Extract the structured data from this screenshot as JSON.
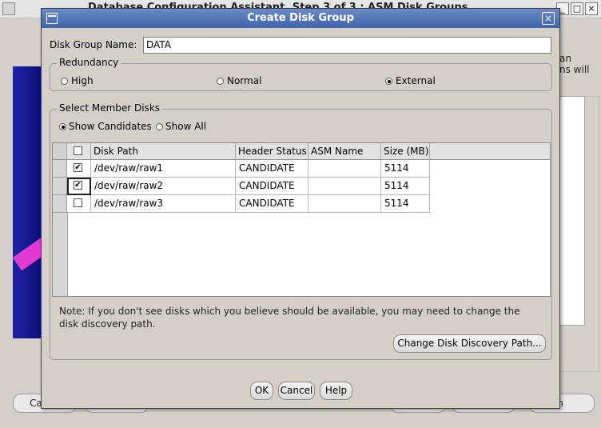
{
  "background_window": {
    "title": "Database Configuration Assistant, Step 3 of 3 : ASM Disk Groups",
    "minimize_label": "_",
    "maximize_label": "□",
    "close_label": "×",
    "right_text": [
      "an",
      "ns will"
    ],
    "bottom_buttons": [
      "Ca",
      "sh"
    ]
  },
  "dialog": {
    "title": "Create Disk Group",
    "close_label": "×",
    "disk_group_name_label": "Disk Group Name:",
    "disk_group_name_value": "DATA",
    "redundancy": {
      "title": "Redundancy",
      "options": [
        "High",
        "Normal",
        "External"
      ],
      "selected": "External"
    },
    "member_disks": {
      "title": "Select Member Disks",
      "filters": [
        "Show Candidates",
        "Show All"
      ],
      "selected_filter": "Show Candidates",
      "columns": [
        "Disk Path",
        "Header Status",
        "ASM Name",
        "Size (MB)"
      ],
      "rows": [
        {
          "checked": true,
          "disk_path": "/dev/raw/raw1",
          "header_status": "CANDIDATE",
          "asm_name": "",
          "size_mb": "5114"
        },
        {
          "checked": true,
          "disk_path": "/dev/raw/raw2",
          "header_status": "CANDIDATE",
          "asm_name": "",
          "size_mb": "5114"
        },
        {
          "checked": false,
          "disk_path": "/dev/raw/raw3",
          "header_status": "CANDIDATE",
          "asm_name": "",
          "size_mb": "5114"
        }
      ],
      "note": "Note: If you don't see disks which you believe should be available, you may need to change the disk discovery path.",
      "change_path_button": "Change Disk Discovery Path..."
    },
    "buttons": {
      "ok": "OK",
      "cancel": "Cancel",
      "help": "Help"
    }
  },
  "colors": {
    "titlebar": "#4a6fb6",
    "dialog_bg": "#d4d0c8",
    "banner": "#1a1c9a",
    "banner_accent": "#e13ad0"
  },
  "icons": {
    "check_mark": "✔"
  }
}
